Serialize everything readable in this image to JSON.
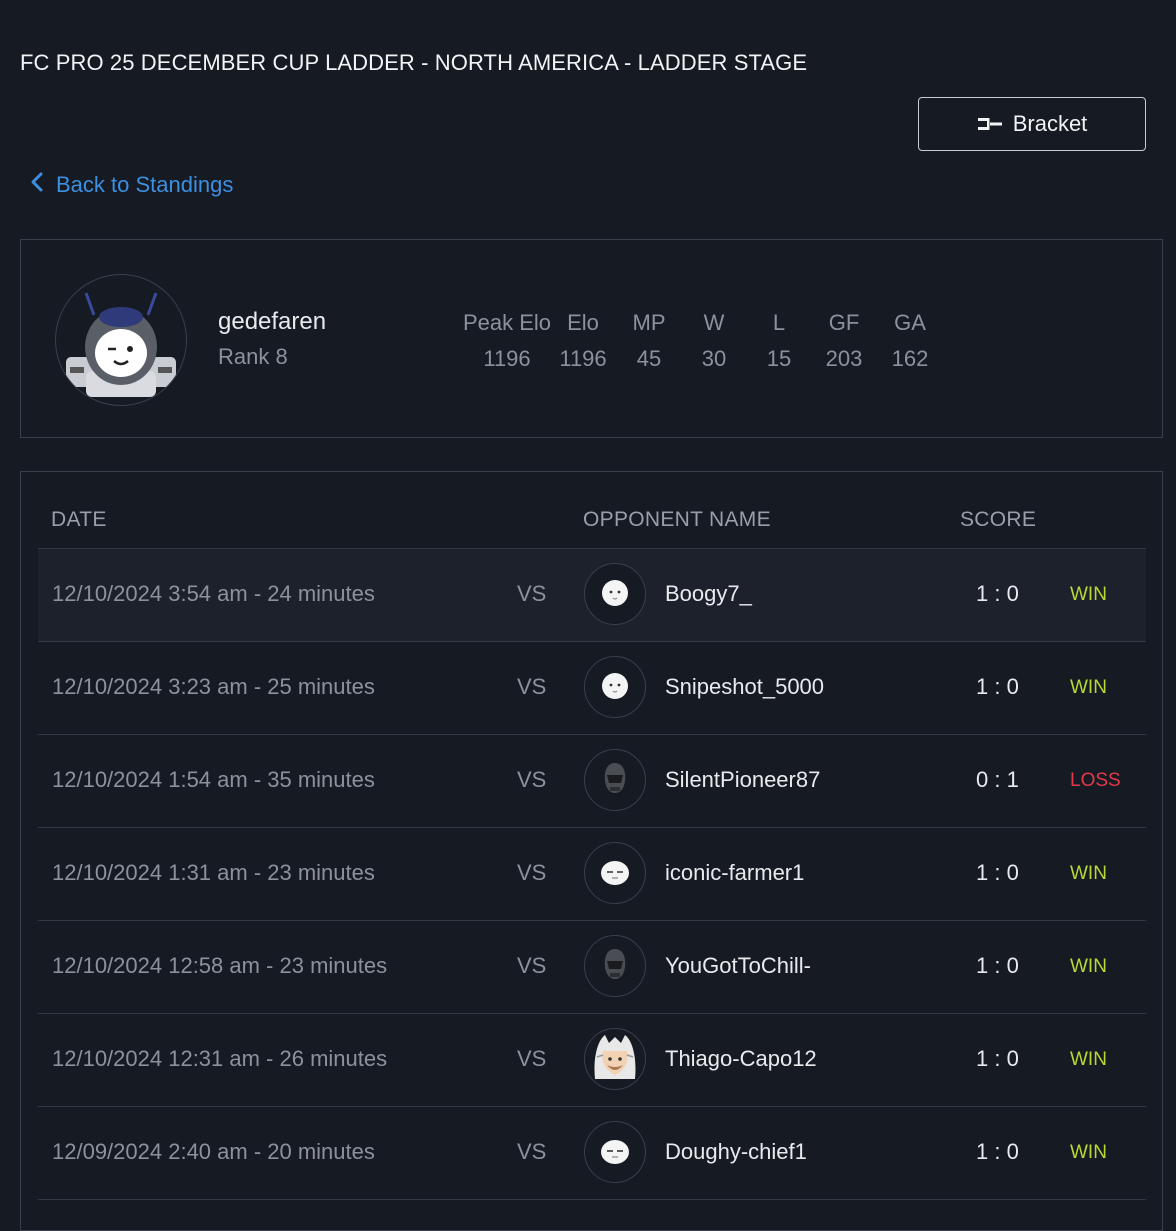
{
  "page": {
    "title": "FC PRO 25 DECEMBER CUP LADDER - NORTH AMERICA - LADDER STAGE",
    "bracket_label": "Bracket",
    "back_label": "Back to Standings"
  },
  "player": {
    "name": "gedefaren",
    "rank": "Rank 8",
    "stats": [
      {
        "label": "Peak Elo",
        "value": "1196"
      },
      {
        "label": "Elo",
        "value": "1196"
      },
      {
        "label": "MP",
        "value": "45"
      },
      {
        "label": "W",
        "value": "30"
      },
      {
        "label": "L",
        "value": "15"
      },
      {
        "label": "GF",
        "value": "203"
      },
      {
        "label": "GA",
        "value": "162"
      }
    ]
  },
  "table": {
    "headers": {
      "date": "DATE",
      "opponent": "OPPONENT NAME",
      "score": "SCORE"
    },
    "vs_label": "VS",
    "rows": [
      {
        "date": "12/10/2024 3:54 am - 24 minutes",
        "opponent": "Boogy7_",
        "avatar": "white-face-icon",
        "score": "1 : 0",
        "result": "WIN"
      },
      {
        "date": "12/10/2024 3:23 am - 25 minutes",
        "opponent": "Snipeshot_5000",
        "avatar": "white-face-icon",
        "score": "1 : 0",
        "result": "WIN"
      },
      {
        "date": "12/10/2024 1:54 am - 35 minutes",
        "opponent": "SilentPioneer87",
        "avatar": "helmet-icon",
        "score": "0 : 1",
        "result": "LOSS"
      },
      {
        "date": "12/10/2024 1:31 am - 23 minutes",
        "opponent": "iconic-farmer1",
        "avatar": "sleepy-face-icon",
        "score": "1 : 0",
        "result": "WIN"
      },
      {
        "date": "12/10/2024 12:58 am - 23 minutes",
        "opponent": "YouGotToChill-",
        "avatar": "helmet-icon",
        "score": "1 : 0",
        "result": "WIN"
      },
      {
        "date": "12/10/2024 12:31 am - 26 minutes",
        "opponent": "Thiago-Capo12",
        "avatar": "wolf-hood-icon",
        "score": "1 : 0",
        "result": "WIN"
      },
      {
        "date": "12/09/2024 2:40 am - 20 minutes",
        "opponent": "Doughy-chief1",
        "avatar": "sleepy-face-icon",
        "score": "1 : 0",
        "result": "WIN"
      }
    ]
  },
  "colors": {
    "win": "#b7d936",
    "loss": "#e3394a",
    "link": "#3d8fe0"
  }
}
